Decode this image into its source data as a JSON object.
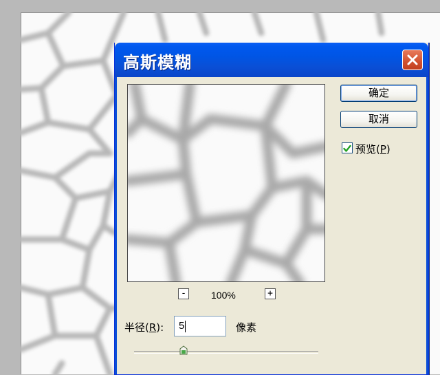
{
  "dialog": {
    "title": "高斯模糊",
    "ok_label": "确定",
    "cancel_label": "取消",
    "preview_label": "预览(",
    "preview_key": "P",
    "preview_close": ")",
    "preview_checked": true,
    "zoom_out": "-",
    "zoom_in": "+",
    "zoom_value": "100%",
    "radius_label": "半径(",
    "radius_key": "R",
    "radius_close": "):",
    "radius_value": "5",
    "radius_unit": "像素",
    "slider_fraction": 0.27
  },
  "colors": {
    "titlebar": "#0055e5",
    "close_button": "#d1512f",
    "dialog_bg": "#ece9d8",
    "cell_line": "#b7b7b7"
  }
}
